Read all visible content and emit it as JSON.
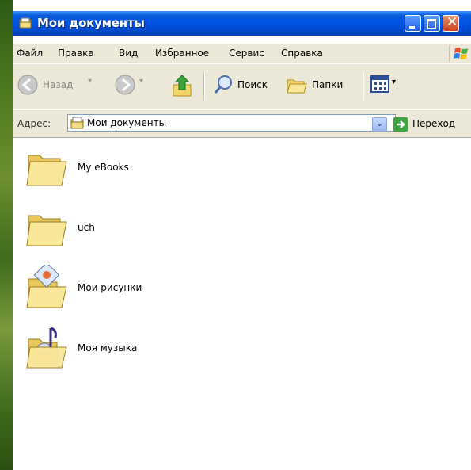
{
  "window": {
    "title": "Мои документы"
  },
  "menu": {
    "items": [
      "Файл",
      "Правка",
      "Вид",
      "Избранное",
      "Сервис",
      "Справка"
    ]
  },
  "toolbar": {
    "back_label": "Назад",
    "search_label": "Поиск",
    "folders_label": "Папки"
  },
  "address": {
    "label": "Адрес:",
    "value": "Мои документы",
    "go_label": "Переход"
  },
  "files": [
    {
      "name": "My eBooks",
      "icon": "folder-icon"
    },
    {
      "name": "uch",
      "icon": "folder-icon"
    },
    {
      "name": "Мои рисунки",
      "icon": "pictures-folder-icon"
    },
    {
      "name": "Моя музыка",
      "icon": "music-folder-icon"
    }
  ],
  "colors": {
    "titlebar": "#0054e3",
    "chrome": "#ece9d8",
    "folder": "#f6e08c"
  }
}
